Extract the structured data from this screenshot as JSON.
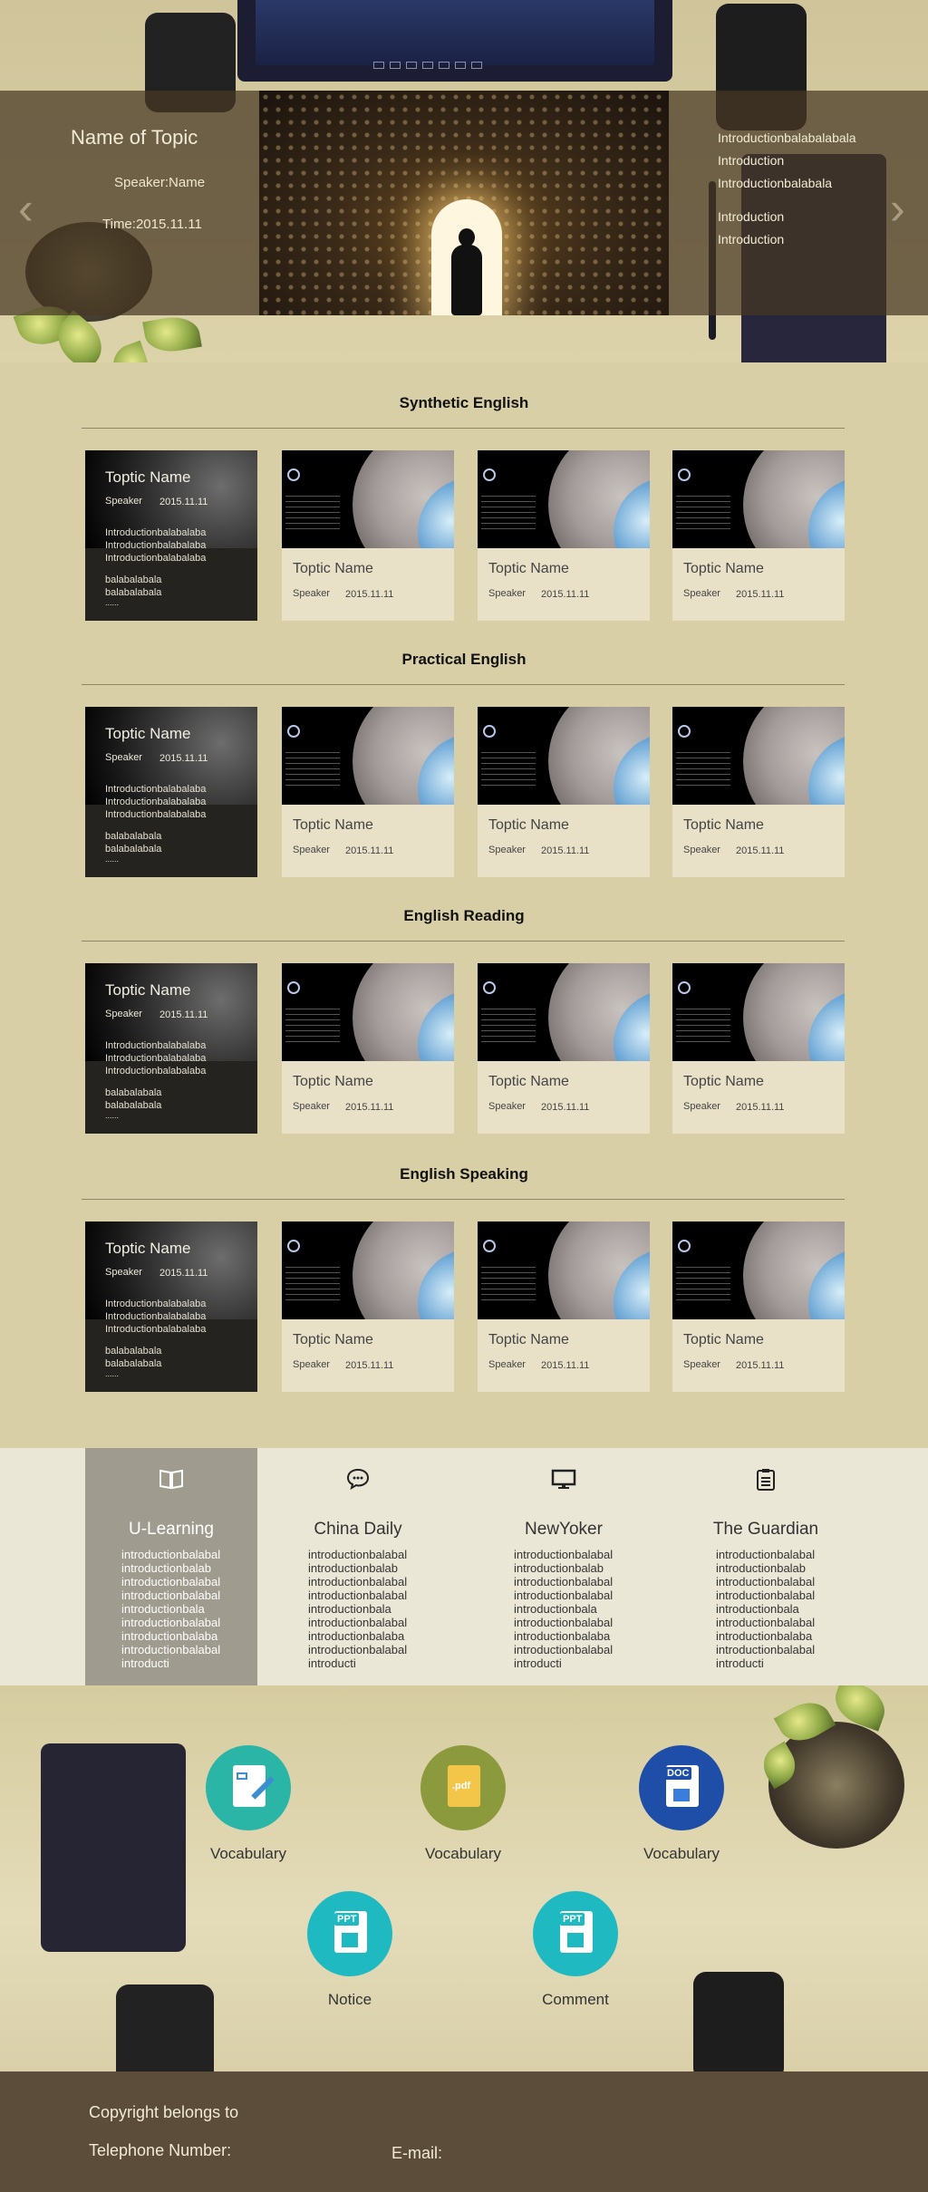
{
  "hero": {
    "title": "Name of Topic",
    "speaker": "Speaker:Name",
    "time": "Time:2015.11.11",
    "intro": [
      "Introductionbalabalabala",
      "Introduction",
      "Introductionbalabala",
      "Introduction",
      "Introduction"
    ],
    "prev_icon": "chevron-left-icon",
    "next_icon": "chevron-right-icon"
  },
  "sections": [
    {
      "title": "Synthetic English"
    },
    {
      "title": "Practical English"
    },
    {
      "title": "English Reading"
    },
    {
      "title": "English Speaking"
    }
  ],
  "featured_card": {
    "title": "Toptic Name",
    "speaker": "Speaker",
    "date": "2015.11.11",
    "intro": [
      "Introductionbalabalaba",
      "Introductionbalabalaba",
      "Introductionbalabalaba"
    ],
    "bala": [
      "balabalabala",
      "balabalabala"
    ],
    "more": "......"
  },
  "card": {
    "title": "Toptic Name",
    "speaker": "Speaker",
    "date": "2015.11.11"
  },
  "resources": [
    {
      "icon": "book-icon",
      "title": "U-Learning",
      "lines": [
        "introductionbalabal",
        "introductionbalab",
        "introductionbalabal",
        "introductionbalabal",
        "introductionbala",
        "introductionbalabal",
        "introductionbalaba",
        "introductionbalabal",
        "introducti"
      ]
    },
    {
      "icon": "chat-bubble-icon",
      "title": "China Daily",
      "lines": [
        "introductionbalabal",
        "introductionbalab",
        "introductionbalabal",
        "introductionbalabal",
        "introductionbala",
        "introductionbalabal",
        "introductionbalaba",
        "introductionbalabal",
        "introducti"
      ]
    },
    {
      "icon": "monitor-icon",
      "title": "NewYoker",
      "lines": [
        "introductionbalabal",
        "introductionbalab",
        "introductionbalabal",
        "introductionbalabal",
        "introductionbala",
        "introductionbalabal",
        "introductionbalaba",
        "introductionbalabal",
        "introducti"
      ]
    },
    {
      "icon": "clipboard-icon",
      "title": "The Guardian",
      "lines": [
        "introductionbalabal",
        "introductionbalab",
        "introductionbalabal",
        "introductionbalabal",
        "introductionbala",
        "introductionbalabal",
        "introductionbalaba",
        "introductionbalabal",
        "introducti"
      ]
    }
  ],
  "downloads": [
    {
      "icon": "document-edit-icon",
      "label": "Vocabulary",
      "color": "#2bb5a6"
    },
    {
      "icon": "pdf-file-icon",
      "label": "Vocabulary",
      "color": "#8c9a3e",
      "badge": ".pdf"
    },
    {
      "icon": "doc-file-icon",
      "label": "Vocabulary",
      "color": "#1f4ea8",
      "badge": "DOC"
    },
    {
      "icon": "ppt-file-icon",
      "label": "Notice",
      "color": "#1fb9c2",
      "badge": "PPT"
    },
    {
      "icon": "ppt-file-icon",
      "label": "Comment",
      "color": "#1fb9c2",
      "badge": "PPT"
    }
  ],
  "footer": {
    "copyright": "Copyright belongs to",
    "telephone": "Telephone Number:",
    "email": "E-mail:"
  },
  "colors": {
    "page_bg": "#d8cfa7",
    "hero_band": "#46372380",
    "footer_bg": "#5b4d3a",
    "resource_strip_bg": "#ebe7d7",
    "resource_active_bg": "#9f9b8e"
  }
}
